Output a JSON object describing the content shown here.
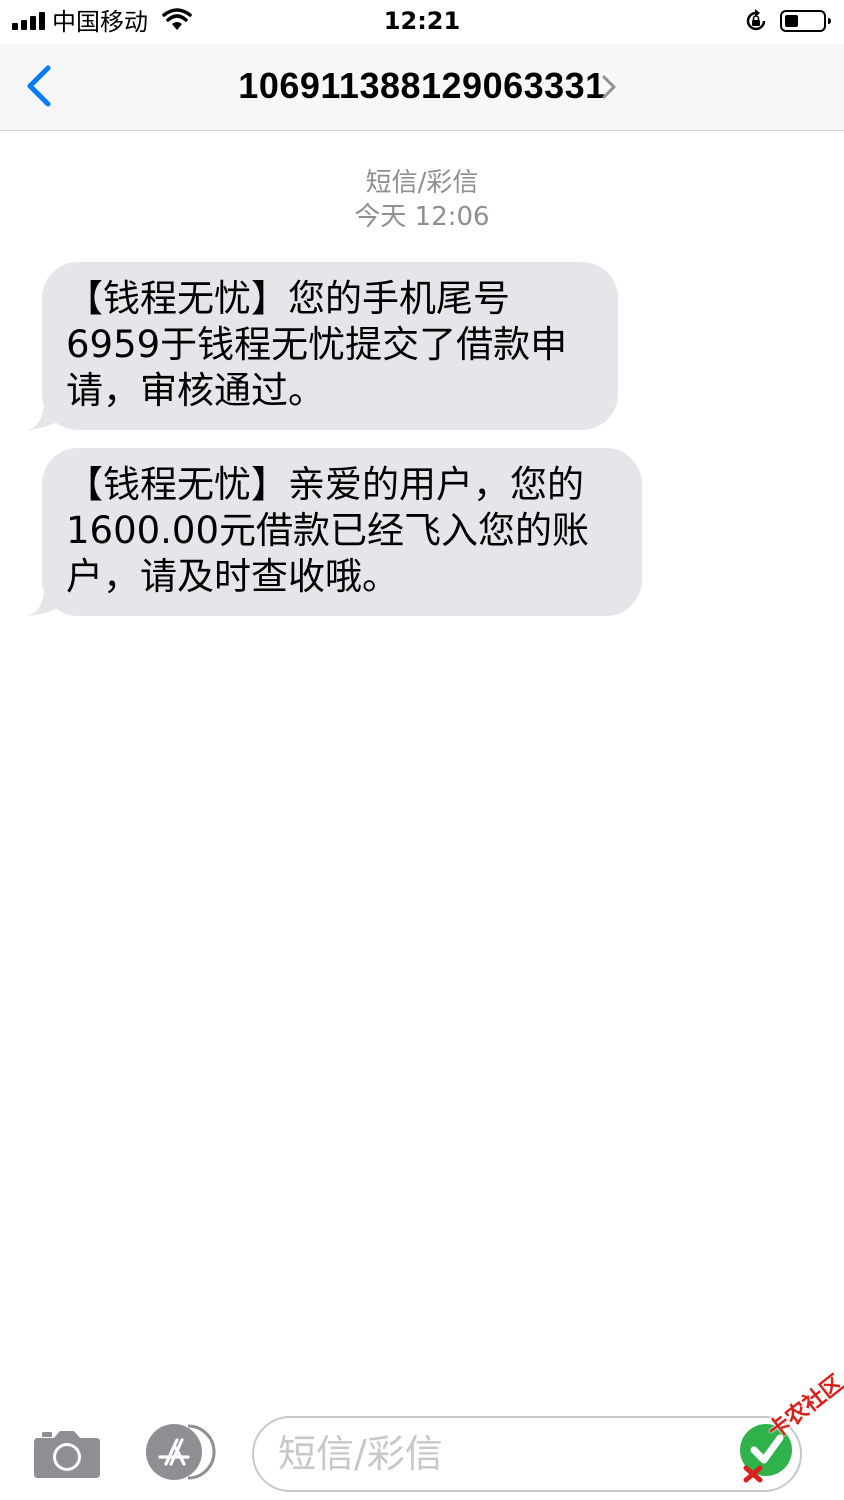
{
  "status_bar": {
    "carrier": "中国移动",
    "time": "12:21"
  },
  "nav": {
    "contact": "106911388129063331"
  },
  "thread": {
    "type_label": "短信/彩信",
    "timestamp": "今天 12:06"
  },
  "messages": [
    {
      "text": "【钱程无忧】您的手机尾号6959于钱程无忧提交了借款申请，审核通过。"
    },
    {
      "text": "【钱程无忧】亲爱的用户，您的1600.00元借款已经飞入您的账户，请及时查收哦。"
    }
  ],
  "input": {
    "placeholder": "短信/彩信"
  },
  "watermark": {
    "text": "卡农社区"
  },
  "colors": {
    "accent": "#007aff",
    "bubble_bg": "#e5e5ea",
    "meta_text": "#8e8e93",
    "placeholder": "#c7c7cc",
    "icon_gray": "#8e8e93"
  }
}
